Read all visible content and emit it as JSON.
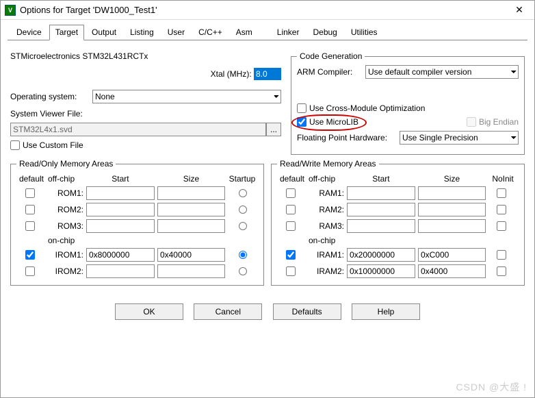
{
  "title": "Options for Target 'DW1000_Test1'",
  "tabs": [
    "Device",
    "Target",
    "Output",
    "Listing",
    "User",
    "C/C++",
    "Asm",
    "Linker",
    "Debug",
    "Utilities"
  ],
  "active_tab": 1,
  "mcu": "STMicroelectronics STM32L431RCTx",
  "xtal_label": "Xtal (MHz):",
  "xtal_value": "8.0",
  "os_label": "Operating system:",
  "os_value": "None",
  "svf_label": "System Viewer File:",
  "svf_value": "STM32L4x1.svd",
  "use_custom_file": "Use Custom File",
  "codegen": {
    "legend": "Code Generation",
    "arm_label": "ARM Compiler:",
    "arm_value": "Use default compiler version",
    "cross": "Use Cross-Module Optimization",
    "microlib": "Use MicroLIB",
    "bigendian": "Big Endian",
    "fph_label": "Floating Point Hardware:",
    "fph_value": "Use Single Precision"
  },
  "ro": {
    "legend": "Read/Only Memory Areas",
    "cols": [
      "default",
      "off-chip",
      "Start",
      "Size",
      "Startup"
    ],
    "onchip": "on-chip",
    "rows": [
      {
        "name": "ROM1:",
        "chk": false,
        "start": "",
        "size": "",
        "startup": false
      },
      {
        "name": "ROM2:",
        "chk": false,
        "start": "",
        "size": "",
        "startup": false
      },
      {
        "name": "ROM3:",
        "chk": false,
        "start": "",
        "size": "",
        "startup": false
      },
      {
        "name": "IROM1:",
        "chk": true,
        "start": "0x8000000",
        "size": "0x40000",
        "startup": true
      },
      {
        "name": "IROM2:",
        "chk": false,
        "start": "",
        "size": "",
        "startup": false
      }
    ]
  },
  "rw": {
    "legend": "Read/Write Memory Areas",
    "cols": [
      "default",
      "off-chip",
      "Start",
      "Size",
      "NoInit"
    ],
    "onchip": "on-chip",
    "rows": [
      {
        "name": "RAM1:",
        "chk": false,
        "start": "",
        "size": "",
        "ni": false
      },
      {
        "name": "RAM2:",
        "chk": false,
        "start": "",
        "size": "",
        "ni": false
      },
      {
        "name": "RAM3:",
        "chk": false,
        "start": "",
        "size": "",
        "ni": false
      },
      {
        "name": "IRAM1:",
        "chk": true,
        "start": "0x20000000",
        "size": "0xC000",
        "ni": false
      },
      {
        "name": "IRAM2:",
        "chk": false,
        "start": "0x10000000",
        "size": "0x4000",
        "ni": false
      }
    ]
  },
  "buttons": {
    "ok": "OK",
    "cancel": "Cancel",
    "defaults": "Defaults",
    "help": "Help"
  },
  "watermark": "CSDN @大盛 !"
}
